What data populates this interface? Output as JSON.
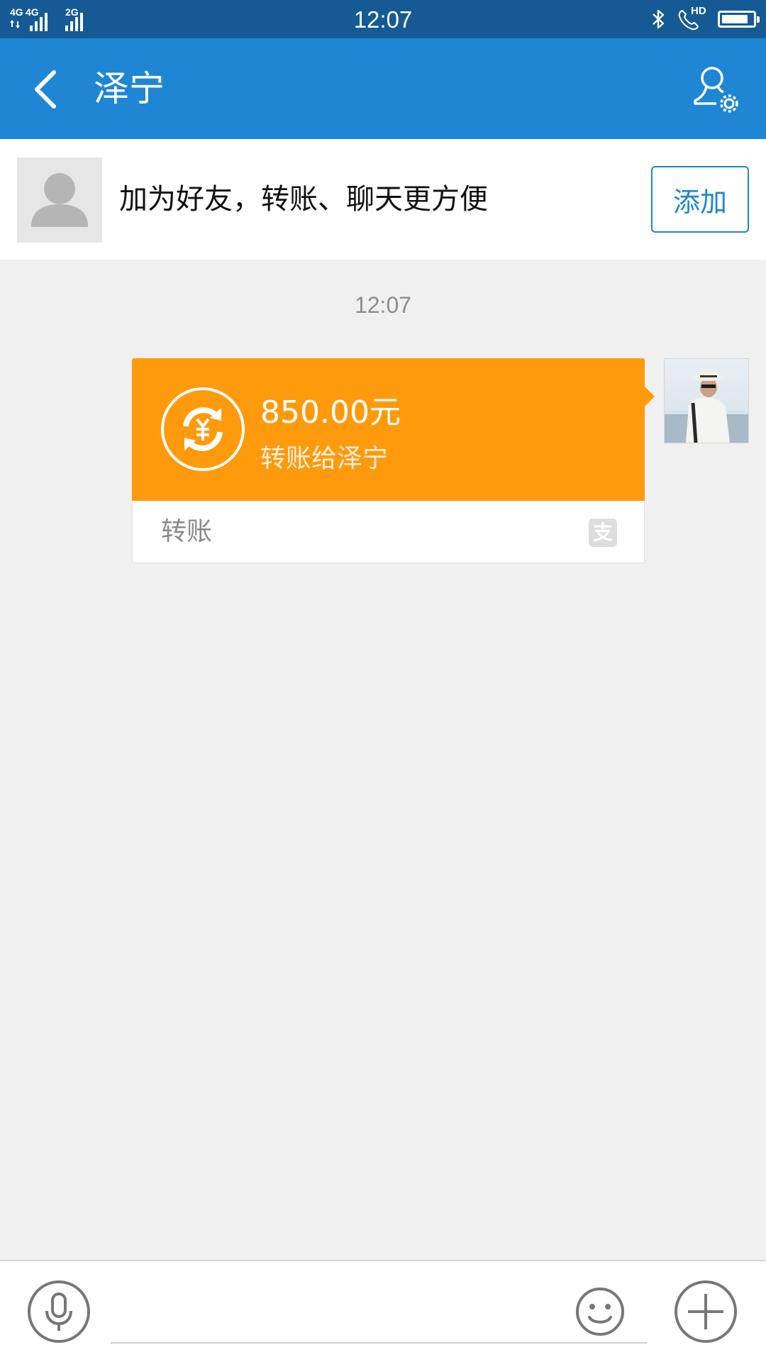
{
  "status_bar": {
    "network_1": "4G",
    "network_2": "4G",
    "network_3": "2G",
    "time": "12:07",
    "call_badge": "HD",
    "battery_level_percent": 85,
    "icons": [
      "signal-icon",
      "bluetooth-icon",
      "hd-call-icon",
      "battery-icon"
    ]
  },
  "header": {
    "title": "泽宁",
    "back_icon": "chevron-left-icon",
    "profile_settings_icon": "user-settings-icon"
  },
  "banner": {
    "text": "加为好友，转账、聊天更方便",
    "add_label": "添加",
    "avatar_icon": "default-avatar-icon"
  },
  "messages": [
    {
      "time": "12:07",
      "type": "transfer",
      "amount": "850.00元",
      "description": "转账给泽宁",
      "footer_label": "转账",
      "footer_icon": "alipay-icon",
      "footer_icon_glyph": "支",
      "card_icon": "yuan-transfer-icon"
    }
  ],
  "input_bar": {
    "message_value": "",
    "icons": [
      "microphone-icon",
      "smiley-icon",
      "plus-icon"
    ]
  },
  "colors": {
    "status_bar": "#155a95",
    "title_bar": "#1e86d4",
    "transfer_card": "#ff9a0c",
    "chat_background": "#f0f0f0",
    "accent": "#1e86d4"
  }
}
